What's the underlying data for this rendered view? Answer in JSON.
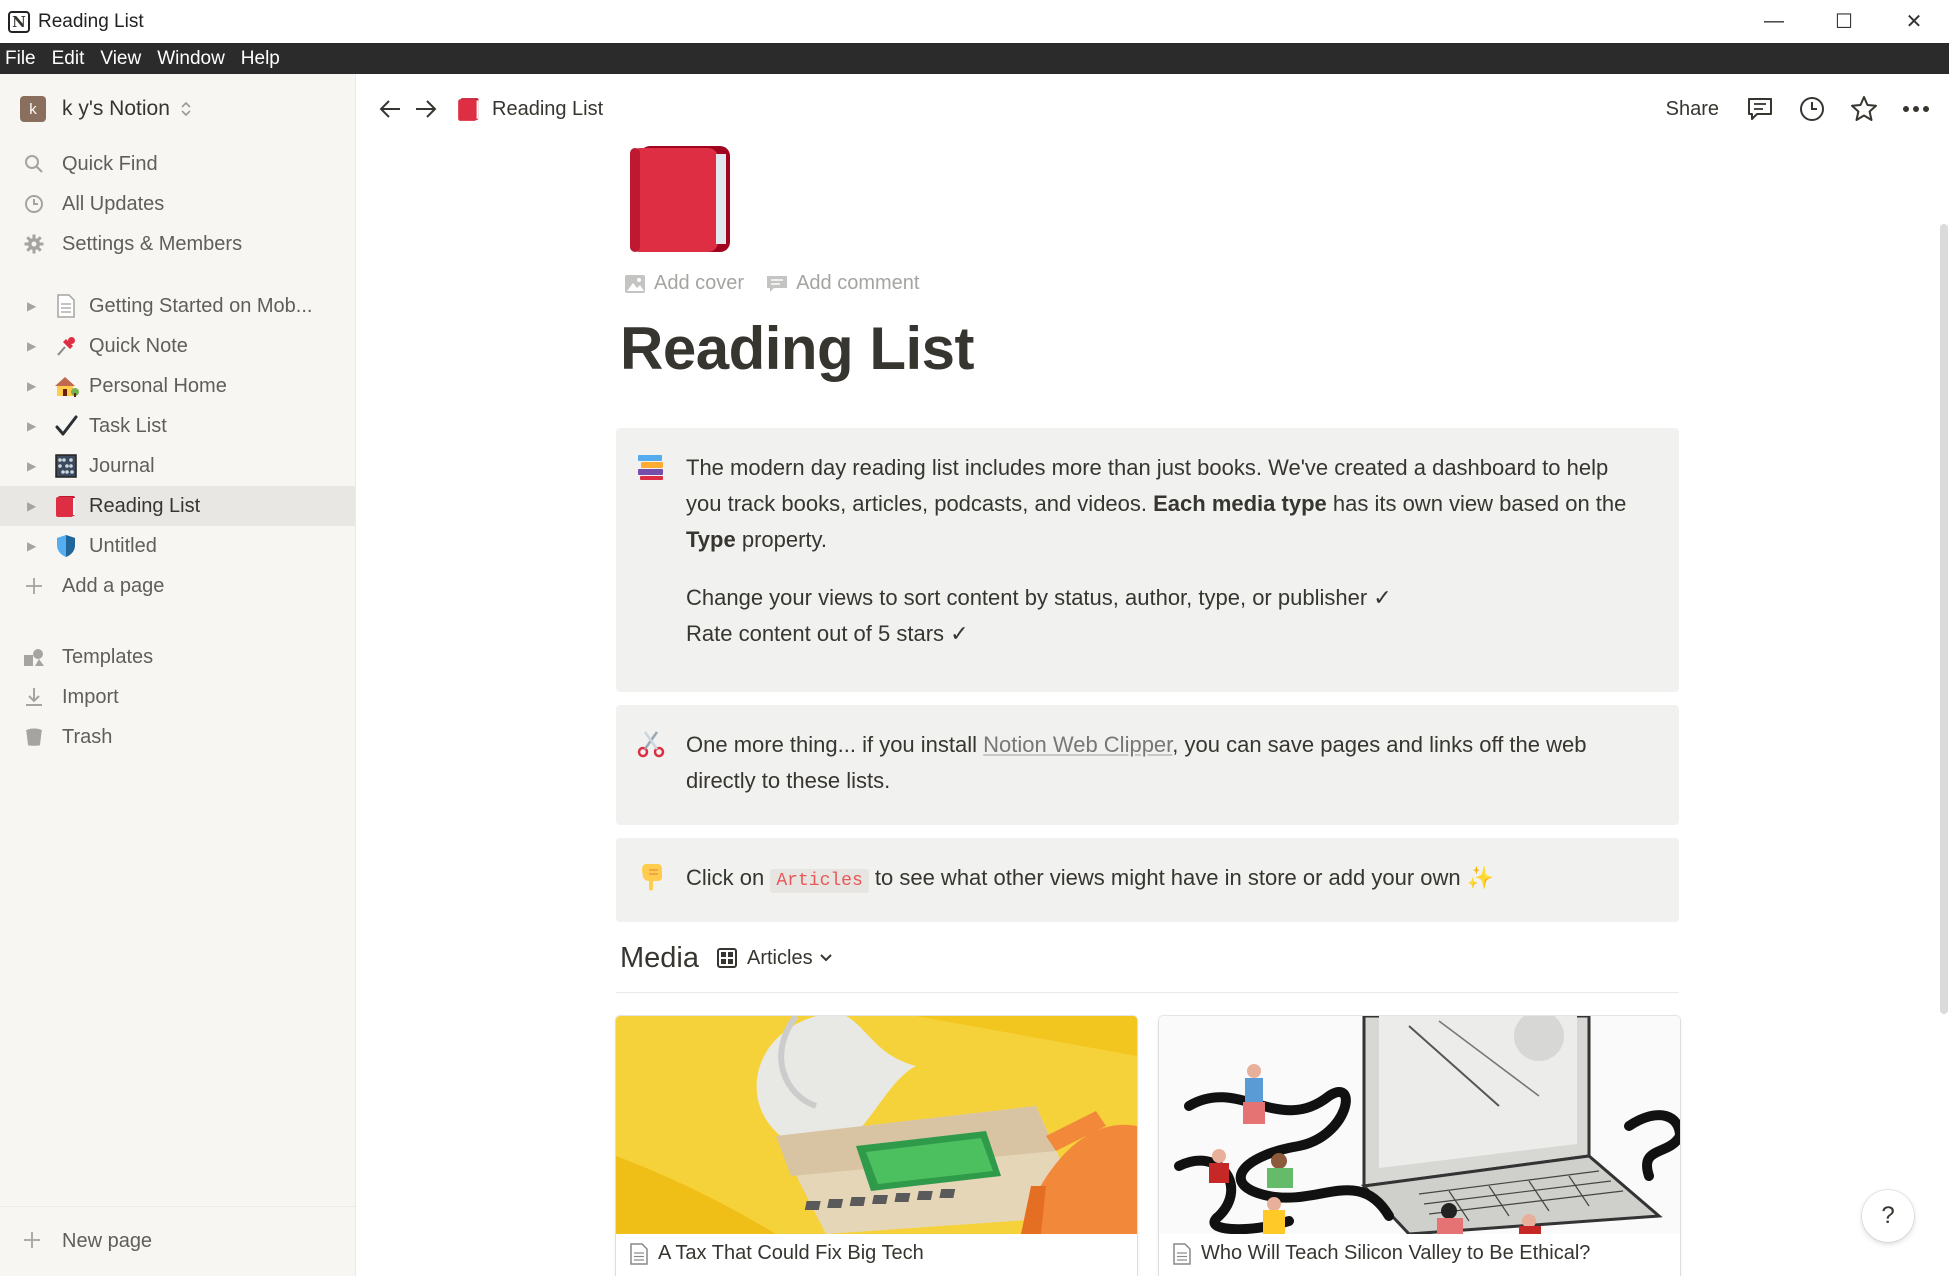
{
  "window": {
    "title": "Reading List",
    "app_icon_letter": "N",
    "controls": {
      "minimize": "—",
      "maximize": "☐",
      "close": "✕"
    }
  },
  "menubar": [
    "File",
    "Edit",
    "View",
    "Window",
    "Help"
  ],
  "sidebar": {
    "workspace": {
      "avatar_letter": "k",
      "name": "k y's Notion"
    },
    "top_items": [
      {
        "label": "Quick Find",
        "icon": "search-icon"
      },
      {
        "label": "All Updates",
        "icon": "clock-icon"
      },
      {
        "label": "Settings & Members",
        "icon": "gear-icon"
      }
    ],
    "pages": [
      {
        "label": "Getting Started on Mob...",
        "icon": "page-icon"
      },
      {
        "label": "Quick Note",
        "icon": "pushpin-icon"
      },
      {
        "label": "Personal Home",
        "icon": "house-icon"
      },
      {
        "label": "Task List",
        "icon": "checkmark-icon"
      },
      {
        "label": "Journal",
        "icon": "abacus-icon"
      },
      {
        "label": "Reading List",
        "icon": "red-book-icon",
        "active": true
      },
      {
        "label": "Untitled",
        "icon": "shield-icon"
      }
    ],
    "add_page": "Add a page",
    "bottom_items": [
      {
        "label": "Templates",
        "icon": "templates-icon"
      },
      {
        "label": "Import",
        "icon": "download-icon"
      },
      {
        "label": "Trash",
        "icon": "trash-icon"
      }
    ],
    "new_page": "New page"
  },
  "topbar": {
    "breadcrumb": "Reading List",
    "share": "Share"
  },
  "page": {
    "add_cover": "Add cover",
    "add_comment": "Add comment",
    "title": "Reading List",
    "callout1": {
      "line1_a": "The modern day reading list includes more than just books. We've created a dashboard to help you track books, articles, podcasts, and videos. ",
      "line1_bold": "Each media type",
      "line1_b": " has its own view based on the ",
      "line1_bold2": "Type",
      "line1_c": " property.",
      "line2": "Change your views to sort content by status, author, type, or publisher ✓",
      "line3": "Rate content out of 5 stars ✓"
    },
    "callout2": {
      "text_a": "One more thing... if you install ",
      "link": "Notion Web Clipper",
      "text_b": ", you can save pages and links off the web directly to these lists."
    },
    "callout3": {
      "text_a": "Click on ",
      "code": "Articles",
      "text_b": " to see what other views might have in store or add your own ✨"
    },
    "media": {
      "title": "Media",
      "view": "Articles"
    },
    "cards": [
      {
        "title": "A Tax That Could Fix Big Tech"
      },
      {
        "title": "Who Will Teach Silicon Valley to Be Ethical?"
      }
    ]
  },
  "help": "?",
  "colors": {
    "sidebar_bg": "#f7f6f3",
    "callout_bg": "#f1f1ef",
    "text": "#37352f",
    "code_red": "#eb5757",
    "book_red": "#d9333f"
  }
}
